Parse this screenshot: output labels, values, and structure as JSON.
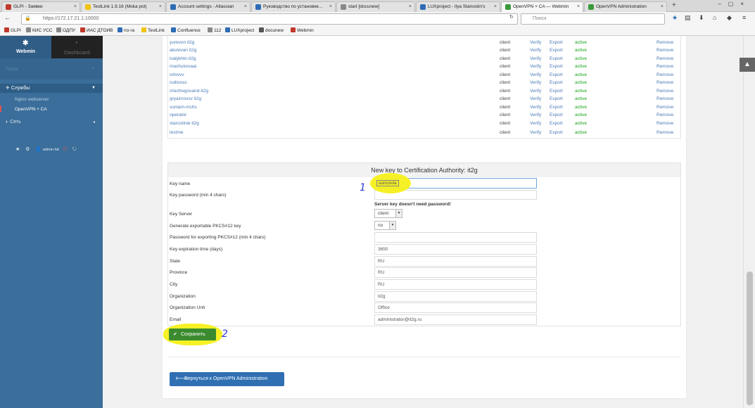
{
  "browser": {
    "tabs": [
      {
        "title": "GLPI - Заявки",
        "color": "#c0392b"
      },
      {
        "title": "TestLink 1.9.16 (Moka pot)",
        "color": "#f1c40f"
      },
      {
        "title": "Account settings - Atlassian",
        "color": "#2d6cb5"
      },
      {
        "title": "Руководство по установке...",
        "color": "#2d6cb5"
      },
      {
        "title": "start [docunew]",
        "color": "#888888"
      },
      {
        "title": "LUXproject - Ilya Stanostin's",
        "color": "#2d6cb5"
      },
      {
        "title": "OpenVPN + CA — Webmin",
        "color": "#3a9a3a",
        "active": true
      },
      {
        "title": "OpenVPN Administration",
        "color": "#3a9a3a"
      }
    ],
    "url": "https://172.17.21.1:10000",
    "search_placeholder": "Поиск",
    "bookmarks": [
      {
        "label": "GLPI",
        "color": "#c0392b"
      },
      {
        "label": "КИС УСС",
        "color": "#888888"
      },
      {
        "label": "ОДПУ",
        "color": "#888888"
      },
      {
        "label": "ИАС ДТОИВ",
        "color": "#c0392b"
      },
      {
        "label": "no-ra",
        "color": "#2d6cb5"
      },
      {
        "label": "TestLink",
        "color": "#f1c40f"
      },
      {
        "label": "Confluence",
        "color": "#2d6cb5"
      },
      {
        "label": "112",
        "color": "#888888"
      },
      {
        "label": "LUXproject",
        "color": "#2d6cb5"
      },
      {
        "label": "docunew",
        "color": "#555555"
      },
      {
        "label": "Webmin",
        "color": "#c0392b"
      }
    ]
  },
  "sidebar": {
    "brand": "Webmin",
    "dashboard": "Dashboard",
    "search_placeholder": "Поиск",
    "category": "Службы",
    "items": [
      "Nginx webserver",
      "OpenVPN + CA"
    ],
    "network": "Сеть",
    "user": "admin-hd"
  },
  "clients": [
    {
      "name": "yurevon it2g",
      "type": "client",
      "verify": "Verify",
      "export": "Export",
      "status": "active",
      "remove": "Remove"
    },
    {
      "name": "akulovan it2g",
      "type": "client",
      "verify": "Verify",
      "export": "Export",
      "status": "active",
      "remove": "Remove"
    },
    {
      "name": "ivalykhin-it2g",
      "type": "client",
      "verify": "Verify",
      "export": "Export",
      "status": "active",
      "remove": "Remove"
    },
    {
      "name": "mashukovaai",
      "type": "client",
      "verify": "Verify",
      "export": "Export",
      "status": "active",
      "remove": "Remove"
    },
    {
      "name": "orlovvv",
      "type": "client",
      "verify": "Verify",
      "export": "Export",
      "status": "active",
      "remove": "Remove"
    },
    {
      "name": "rudionss",
      "type": "client",
      "verify": "Verify",
      "export": "Export",
      "status": "active",
      "remove": "Remove"
    },
    {
      "name": "chezhegovand-it2g",
      "type": "client",
      "verify": "Verify",
      "export": "Export",
      "status": "active",
      "remove": "Remove"
    },
    {
      "name": "gryaznovsv it2g",
      "type": "client",
      "verify": "Verify",
      "export": "Export",
      "status": "active",
      "remove": "Remove"
    },
    {
      "name": "suniam-mchs",
      "type": "client",
      "verify": "Verify",
      "export": "Export",
      "status": "active",
      "remove": "Remove"
    },
    {
      "name": "operator",
      "type": "client",
      "verify": "Verify",
      "export": "Export",
      "status": "active",
      "remove": "Remove"
    },
    {
      "name": "starostinie it2g",
      "type": "client",
      "verify": "Verify",
      "export": "Export",
      "status": "active",
      "remove": "Remove"
    },
    {
      "name": "testme",
      "type": "client",
      "verify": "Verify",
      "export": "Export",
      "status": "active",
      "remove": "Remove"
    }
  ],
  "form": {
    "title": "New key to Certification Authority: it2g",
    "key_name_label": "Key name",
    "key_name_value": "suncovia",
    "key_password_label": "Key password (min 4 chars)",
    "key_password_value": "",
    "no_password_note": "Server key doesn't need password!",
    "key_server_label": "Key Server",
    "key_server_value": "client",
    "pkcs_label": "Generate exportable PKCS#12 key",
    "pkcs_value": "no",
    "pkcs_password_label": "Password for exporting PKCS#12 (min 4 chars)",
    "pkcs_password_value": "",
    "expiration_label": "Key expiration time (days)",
    "expiration_value": "3650",
    "state_label": "State",
    "state_value": "RU",
    "province_label": "Province",
    "province_value": "RU",
    "city_label": "City",
    "city_value": "RU",
    "org_label": "Organization",
    "org_value": "it2g",
    "org_unit_label": "Organization Unit",
    "org_unit_value": "Office",
    "email_label": "Email",
    "email_value": "administrator@it2g.ru"
  },
  "buttons": {
    "save": "Сохранить",
    "back": "Вернуться к OpenVPN Administration"
  },
  "annotations": {
    "one": "1",
    "two": "2"
  }
}
